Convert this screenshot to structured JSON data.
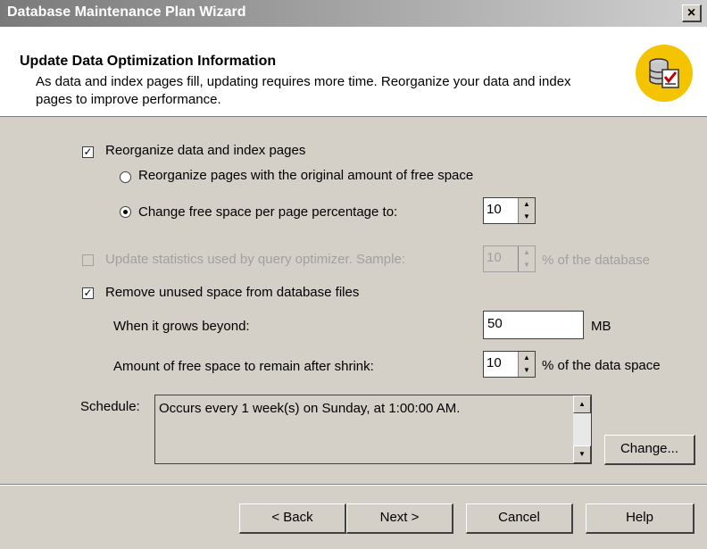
{
  "window": {
    "title": "Database Maintenance Plan Wizard",
    "close_glyph": "×"
  },
  "header": {
    "title": "Update Data Optimization Information",
    "description": "As data and index pages fill, updating requires more time. Reorganize your data and index pages to improve performance."
  },
  "options": {
    "reorganize": {
      "label": "Reorganize data and index pages",
      "checked": true
    },
    "radio_original": {
      "label": "Reorganize pages with the original amount of free space",
      "selected": false
    },
    "radio_change": {
      "label": "Change free space per page percentage to:",
      "selected": true,
      "value": "10"
    },
    "update_stats": {
      "label": "Update statistics used by query optimizer. Sample:",
      "checked": false,
      "enabled": false,
      "value": "10",
      "suffix": "% of the database"
    },
    "remove_unused": {
      "label": "Remove unused space from database files",
      "checked": true
    },
    "grows_beyond": {
      "label": "When it grows beyond:",
      "value": "50",
      "unit": "MB"
    },
    "free_after_shrink": {
      "label": "Amount of free space to remain after shrink:",
      "value": "10",
      "suffix": "% of the data space"
    }
  },
  "schedule": {
    "label": "Schedule:",
    "text": "Occurs every 1 week(s) on Sunday, at 1:00:00 AM.",
    "change_button": "Change..."
  },
  "footer": {
    "back": "< Back",
    "next": "Next >",
    "cancel": "Cancel",
    "help": "Help"
  },
  "icons": {
    "check_glyph": "✓",
    "up_arrow": "▲",
    "down_arrow": "▼"
  },
  "colors": {
    "dialog_bg": "#d4d0c8",
    "header_bg": "#ffffff",
    "icon_circle": "#f5c400",
    "disabled_text": "#a0a0a0"
  }
}
